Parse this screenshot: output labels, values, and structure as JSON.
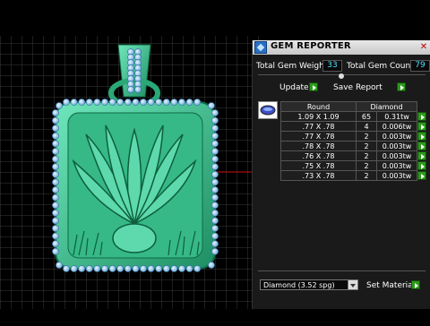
{
  "panel": {
    "title": "GEM REPORTER",
    "total_weight_label": "Total Gem Weight",
    "total_weight_value": "33",
    "total_count_label": "Total Gem Count",
    "total_count_value": "79",
    "update_label": "Update",
    "save_report_label": "Save Report",
    "table": {
      "headers": [
        "Round",
        "Diamond"
      ],
      "rows": [
        {
          "size": "1.09 X 1.09",
          "count": "65",
          "weight": "0.31tw"
        },
        {
          "size": ".77 X .78",
          "count": "4",
          "weight": "0.006tw"
        },
        {
          "size": ".77 X .78",
          "count": "2",
          "weight": "0.003tw"
        },
        {
          "size": ".78 X .78",
          "count": "2",
          "weight": "0.003tw"
        },
        {
          "size": ".76 X .78",
          "count": "2",
          "weight": "0.003tw"
        },
        {
          "size": ".75 X .78",
          "count": "2",
          "weight": "0.003tw"
        },
        {
          "size": ".73 X .78",
          "count": "2",
          "weight": "0.003tw"
        }
      ]
    },
    "material_select": "Diamond    (3.52 spg)",
    "set_material_label": "Set Material"
  },
  "colors": {
    "pendant": "#3fc79a",
    "gem": "#a8d8ff",
    "value_text": "#4de0ff",
    "go_button": "#2c9a1a"
  }
}
